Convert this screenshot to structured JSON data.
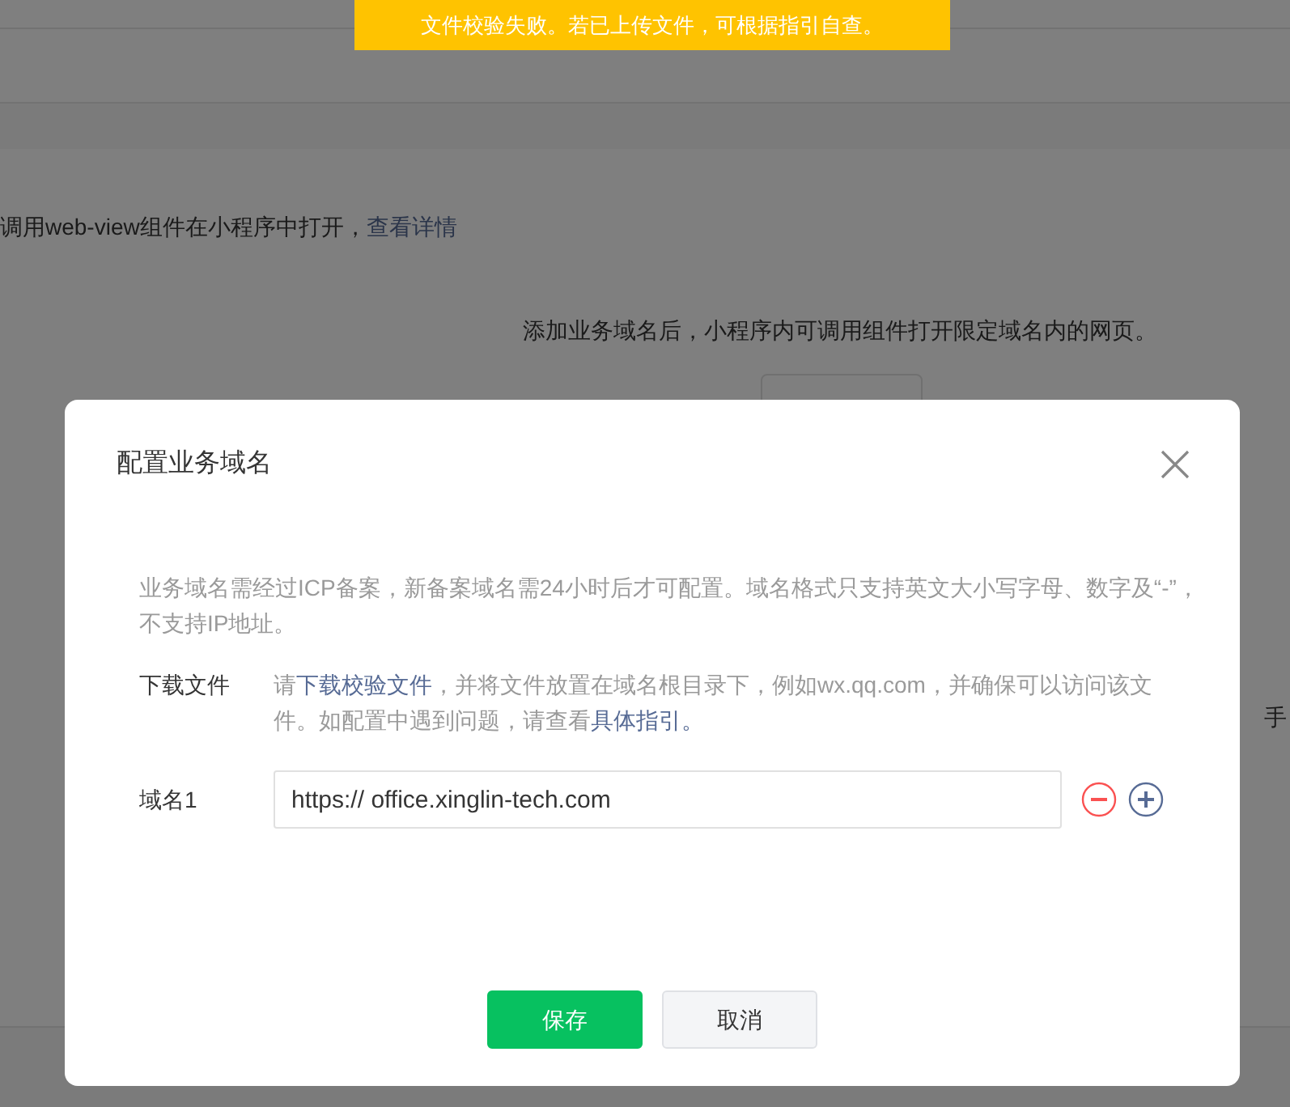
{
  "toast": {
    "text": "文件校验失败。若已上传文件，可根据指引自查。"
  },
  "background": {
    "intro_text": "调用web-view组件在小程序中打开，",
    "intro_link": "查看详情",
    "description": "添加业务域名后，小程序内可调用组件打开限定域名内的网页。",
    "edge_text": "手"
  },
  "dialog": {
    "title": "配置业务域名",
    "notice": "业务域名需经过ICP备案，新备案域名需24小时后才可配置。域名格式只支持英文大小写字母、数字及“-”，不支持IP地址。",
    "download": {
      "label": "下载文件",
      "parts": [
        {
          "text": "请",
          "kind": "text"
        },
        {
          "text": "下载校验文件",
          "kind": "link"
        },
        {
          "text": "，并将文件放置在域名根目录下，例如wx.qq.com，并确保可以访问该文件。如配置中遇到问题，请查看",
          "kind": "text"
        },
        {
          "text": "具体指引。",
          "kind": "link"
        }
      ]
    },
    "domains": [
      {
        "label": "域名1",
        "value": "https:// office.xinglin-tech.com"
      }
    ],
    "buttons": [
      {
        "label": "保存",
        "kind": "primary"
      },
      {
        "label": "取消",
        "kind": "secondary"
      }
    ]
  }
}
